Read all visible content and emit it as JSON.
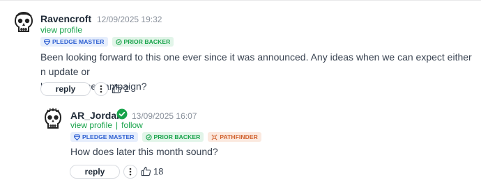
{
  "comments": [
    {
      "author": "Ravencroft",
      "timestamp": "12/09/2025 19:32",
      "view_profile": "view profile",
      "badges": [
        "PLEDGE MASTER",
        "PRIOR BACKER"
      ],
      "body_line1": "Been looking forward to this one ever since it was announced. Any ideas when we can expect either n update or",
      "body_line2": "launch of the campaign?",
      "reply_label": "reply",
      "likes": "2"
    },
    {
      "author": "AR_Jordan",
      "timestamp": "13/09/2025 16:07",
      "view_profile": "view profile",
      "separator": "|",
      "follow": "follow",
      "badges": [
        "PLEDGE MASTER",
        "PRIOR BACKER",
        "PATHFINDER"
      ],
      "body": "How does later this month sound?",
      "reply_label": "reply",
      "likes": "18"
    }
  ],
  "colors": {
    "accent_green": "#17a34a",
    "badge_blue": "#2d5fd1",
    "badge_green": "#18a34a",
    "badge_orange": "#d0602c"
  },
  "icons": {
    "avatar_1": "skull-icon",
    "avatar_2": "skull-icon",
    "verified": "check-badge-icon",
    "diamond": "diamond-icon",
    "backer": "refresh-check-icon",
    "pathfinder": "compass-icon",
    "more": "more-vertical-icon",
    "like": "thumbs-up-icon"
  }
}
